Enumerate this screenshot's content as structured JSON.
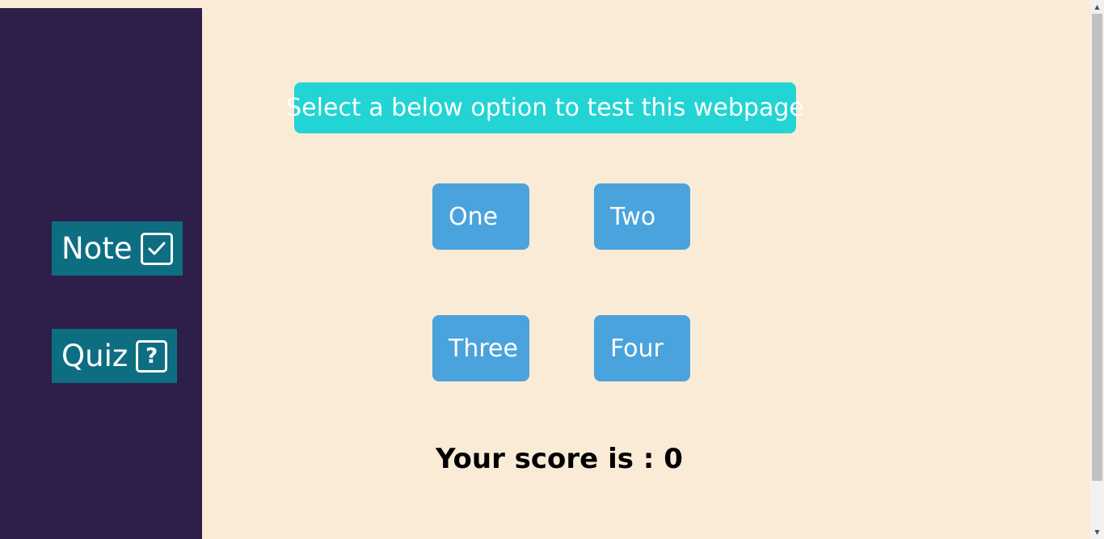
{
  "sidebar": {
    "note_label": "Note",
    "note_icon": "checkbox-checked-icon",
    "quiz_label": "Quiz",
    "quiz_icon": "question-box-icon"
  },
  "main": {
    "prompt": "Select a below option to test this webpage",
    "options": [
      "One",
      "Two",
      "Three",
      "Four"
    ],
    "score_text": "Your score is : 0"
  },
  "colors": {
    "background": "#faebd7",
    "sidebar": "#2e1e4a",
    "sidebar_button": "#0d6e82",
    "prompt": "#22d4d4",
    "option": "#4aa3dc"
  }
}
